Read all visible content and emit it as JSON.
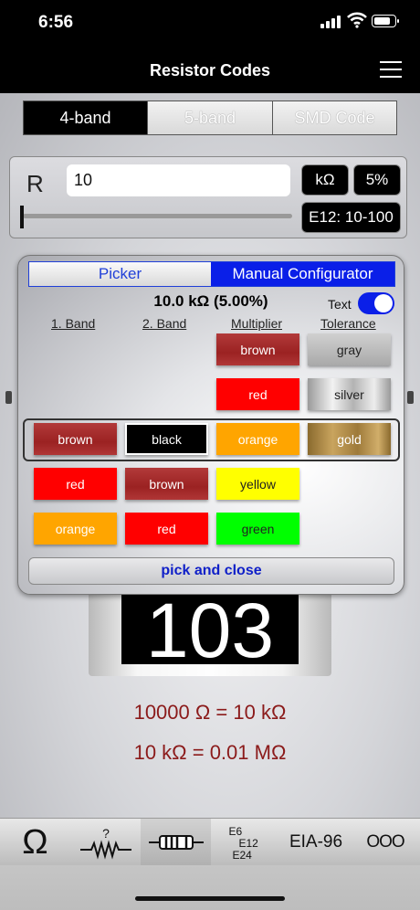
{
  "status": {
    "time": "6:56"
  },
  "header": {
    "title": "Resistor Codes"
  },
  "segments": [
    {
      "label": "4-band",
      "active": true
    },
    {
      "label": "5-band",
      "active": false
    },
    {
      "label": "SMD Code",
      "active": false
    }
  ],
  "resistance": {
    "label": "R",
    "value": "10",
    "unit": "kΩ",
    "tolerance": "5%",
    "series": "E12: 10-100",
    "slider_fraction": 0.0
  },
  "picker": {
    "tabs": [
      {
        "label": "Picker"
      },
      {
        "label": "Manual Configurator"
      }
    ],
    "summary": "10.0 kΩ (5.00%)",
    "text_toggle_label": "Text",
    "text_toggle_on": true,
    "columns": [
      "1. Band",
      "2. Band",
      "Multiplier",
      "Tolerance"
    ],
    "rows": [
      [
        null,
        null,
        {
          "label": "brown",
          "color": "#a52a2a"
        },
        {
          "label": "gray",
          "color": "#b5b5b5"
        }
      ],
      [
        null,
        null,
        {
          "label": "red",
          "color": "#ff0000"
        },
        {
          "label": "silver",
          "color": "#c0c0c0"
        }
      ],
      [
        {
          "label": "brown",
          "color": "#a52a2a"
        },
        {
          "label": "black",
          "color": "#000000"
        },
        {
          "label": "orange",
          "color": "#ffa500"
        },
        {
          "label": "gold",
          "color": "#b8893e"
        }
      ],
      [
        {
          "label": "red",
          "color": "#ff0000"
        },
        {
          "label": "brown",
          "color": "#a52a2a"
        },
        {
          "label": "yellow",
          "color": "#ffff00"
        },
        null
      ],
      [
        {
          "label": "orange",
          "color": "#ffa500"
        },
        {
          "label": "red",
          "color": "#ff0000"
        },
        {
          "label": "green",
          "color": "#00ff00"
        },
        null
      ]
    ],
    "selected_row": 2,
    "close_label": "pick and close"
  },
  "smd": {
    "code": "103"
  },
  "conversions": [
    "10000 Ω = 10 kΩ",
    "10 kΩ = 0.01 MΩ"
  ],
  "tabbar": {
    "items": [
      {
        "id": "ohm",
        "label": "Ω"
      },
      {
        "id": "unknown-resistor",
        "label": "?"
      },
      {
        "id": "resistor",
        "label": ""
      },
      {
        "id": "e-series",
        "lines": [
          "E6",
          "E12",
          "E24"
        ]
      },
      {
        "id": "eia96",
        "label": "EIA-96"
      },
      {
        "id": "more",
        "label": "OOO"
      }
    ],
    "active": "resistor"
  }
}
